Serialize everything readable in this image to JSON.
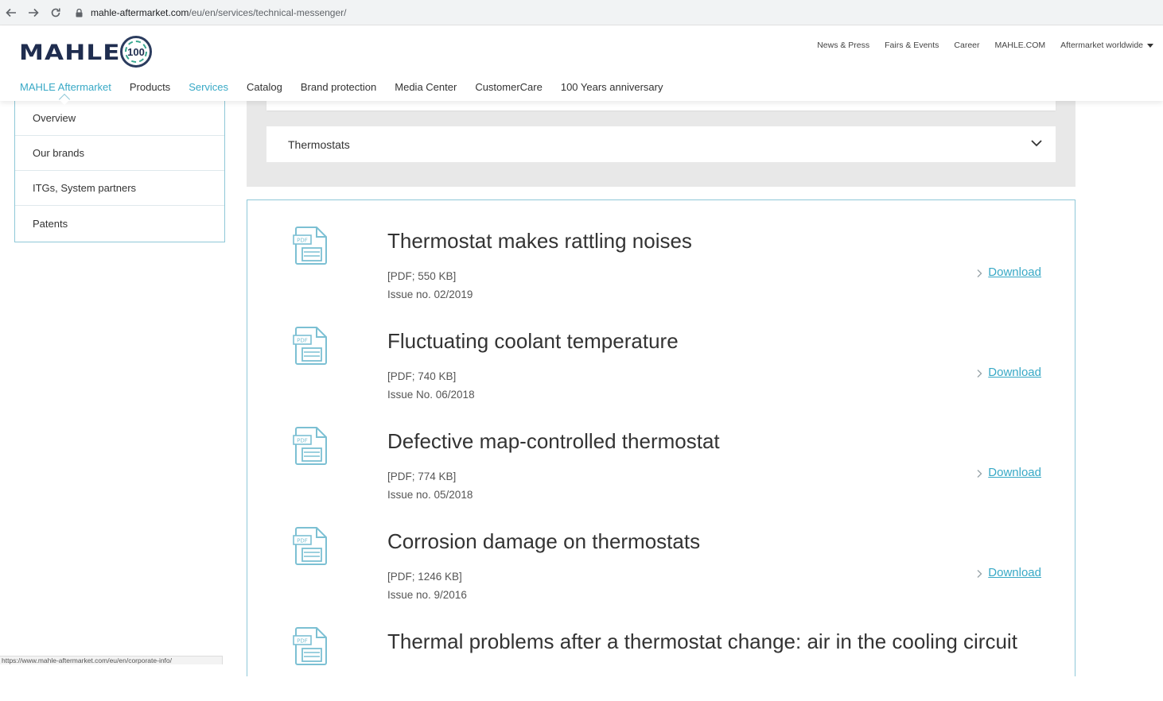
{
  "browser": {
    "url_domain": "mahle-aftermarket.com",
    "url_path": "/eu/en/services/technical-messenger/",
    "status_url": "https://www.mahle-aftermarket.com/eu/en/corporate-info/"
  },
  "header": {
    "logo_text": "MAHLE",
    "anniversary_badge": "100",
    "top_links": [
      "News & Press",
      "Fairs & Events",
      "Career",
      "MAHLE.COM",
      "Aftermarket worldwide"
    ],
    "main_nav": [
      "MAHLE Aftermarket",
      "Products",
      "Services",
      "Catalog",
      "Brand protection",
      "Media Center",
      "CustomerCare",
      "100 Years anniversary"
    ],
    "active_color": "#38a9c6"
  },
  "submenu": {
    "items": [
      "Overview",
      "Our brands",
      "ITGs, System partners",
      "Patents"
    ]
  },
  "filter": {
    "selected": "Thermostats"
  },
  "documents": [
    {
      "title": "Thermostat makes rattling noises",
      "info": "[PDF; 550 KB]",
      "issue": "Issue no. 02/2019",
      "download": "Download"
    },
    {
      "title": "Fluctuating coolant temperature",
      "info": "[PDF; 740 KB]",
      "issue": "Issue No. 06/2018",
      "download": "Download"
    },
    {
      "title": "Defective map-controlled thermostat",
      "info": "[PDF; 774 KB]",
      "issue": "Issue no. 05/2018",
      "download": "Download"
    },
    {
      "title": "Corrosion damage on thermostats",
      "info": "[PDF; 1246 KB]",
      "issue": "Issue no. 9/2016",
      "download": "Download"
    },
    {
      "title": "Thermal problems after a thermostat change: air in the cooling circuit",
      "info": "",
      "issue": "",
      "download": ""
    }
  ],
  "icons": {
    "document": "pdf-file-icon",
    "link_arrow": "chevron-right-icon"
  }
}
